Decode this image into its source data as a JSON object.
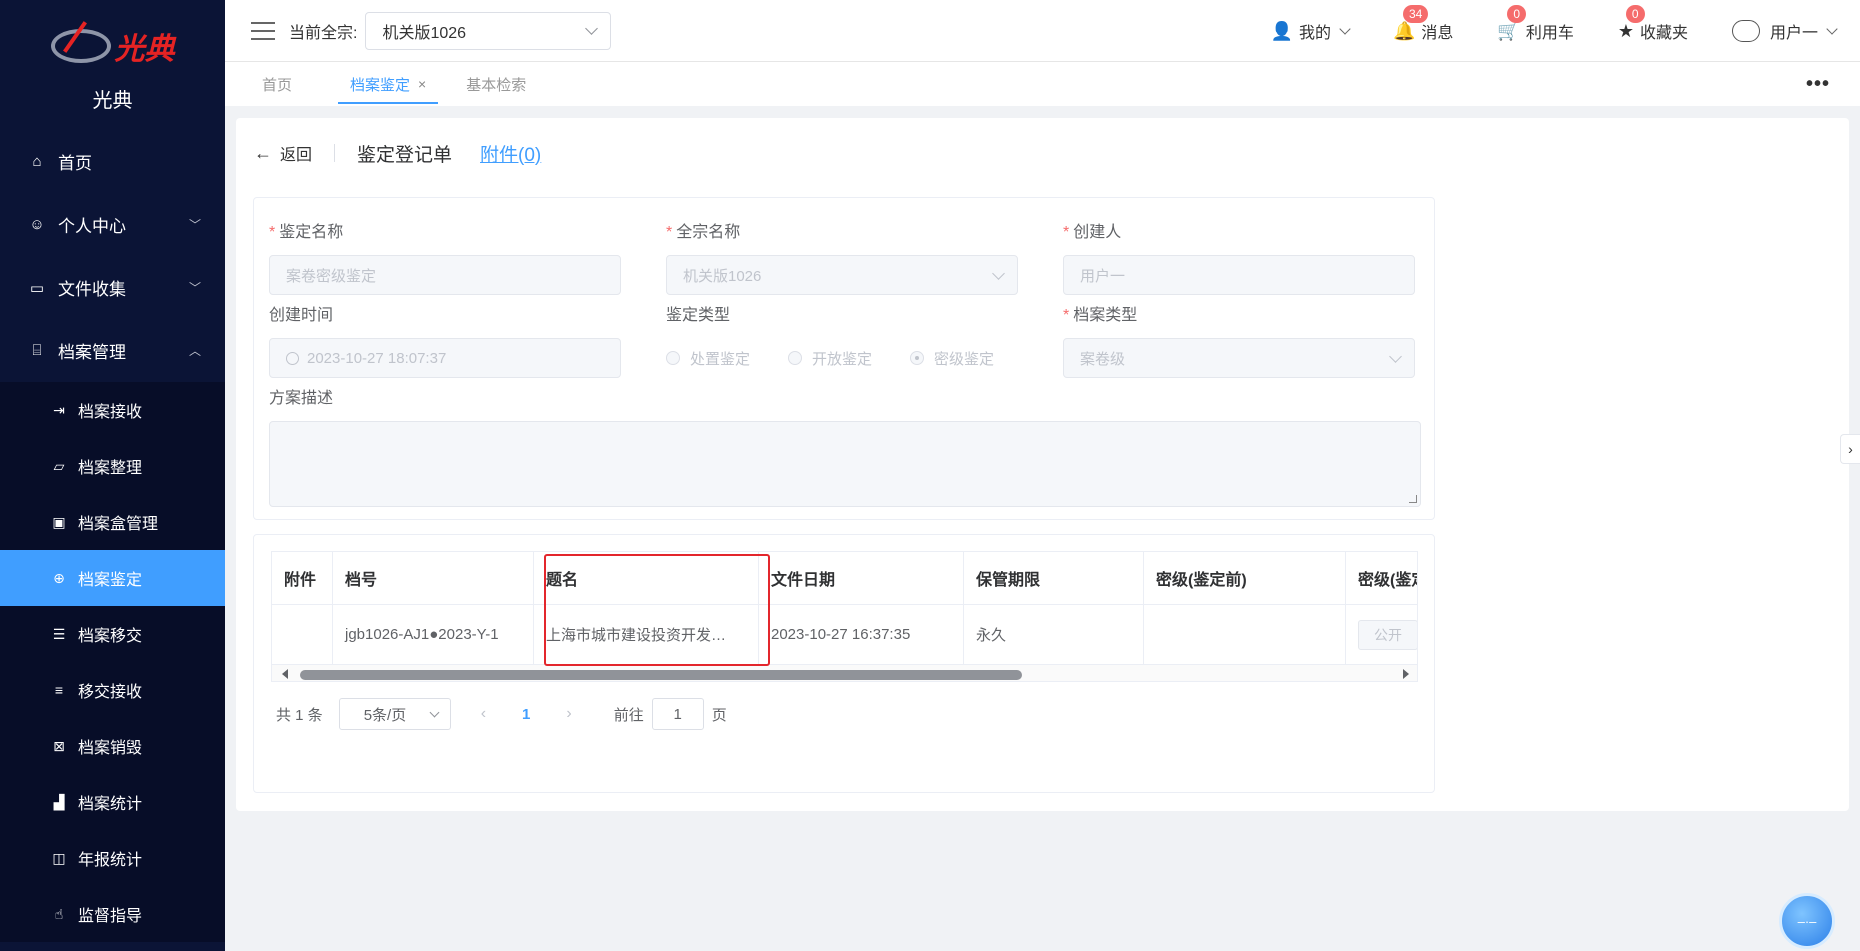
{
  "app": {
    "brand": "光典",
    "logo_text": "光典"
  },
  "sidebar": {
    "items": [
      {
        "label": "首页",
        "icon": "home-icon"
      },
      {
        "label": "个人中心",
        "icon": "user-icon"
      },
      {
        "label": "文件收集",
        "icon": "tray-icon"
      },
      {
        "label": "档案管理",
        "icon": "bank-icon"
      }
    ],
    "sub_items": [
      {
        "label": "档案接收"
      },
      {
        "label": "档案整理"
      },
      {
        "label": "档案盒管理"
      },
      {
        "label": "档案鉴定"
      },
      {
        "label": "档案移交"
      },
      {
        "label": "移交接收"
      },
      {
        "label": "档案销毁"
      },
      {
        "label": "档案统计"
      },
      {
        "label": "年报统计"
      },
      {
        "label": "监督指导"
      }
    ]
  },
  "header": {
    "current_label": "当前全宗:",
    "current_value": "机关版1026",
    "mine": "我的",
    "messages": "消息",
    "messages_count": "34",
    "cart": "利用车",
    "cart_count": "0",
    "favorites": "收藏夹",
    "favorites_count": "0",
    "user": "用户一"
  },
  "tabs": {
    "items": [
      {
        "label": "首页"
      },
      {
        "label": "档案鉴定"
      },
      {
        "label": "基本检索"
      }
    ],
    "close": "×",
    "more": "•••"
  },
  "page": {
    "back": "返回",
    "title": "鉴定登记单",
    "attachment": "附件(0)"
  },
  "form": {
    "name_label": "鉴定名称",
    "name_value": "案卷密级鉴定",
    "fonds_label": "全宗名称",
    "fonds_value": "机关版1026",
    "creator_label": "创建人",
    "creator_value": "用户一",
    "created_label": "创建时间",
    "created_value": "2023-10-27 18:07:37",
    "type_label": "鉴定类型",
    "type_options": [
      "处置鉴定",
      "开放鉴定",
      "密级鉴定"
    ],
    "archive_type_label": "档案类型",
    "archive_type_value": "案卷级",
    "desc_label": "方案描述"
  },
  "table": {
    "columns": [
      "附件",
      "档号",
      "题名",
      "文件日期",
      "保管期限",
      "密级(鉴定前)",
      "密级(鉴定"
    ],
    "rows": [
      [
        "",
        "jgb1026-AJ1●2023-Y-1",
        "上海市城市建设投资开发…",
        "2023-10-27 16:37:35",
        "永久",
        "",
        "公开"
      ]
    ]
  },
  "pager": {
    "total": "共 1 条",
    "page_size": "5条/页",
    "current": "1",
    "goto_label": "前往",
    "goto_value": "1",
    "goto_suffix": "页"
  }
}
